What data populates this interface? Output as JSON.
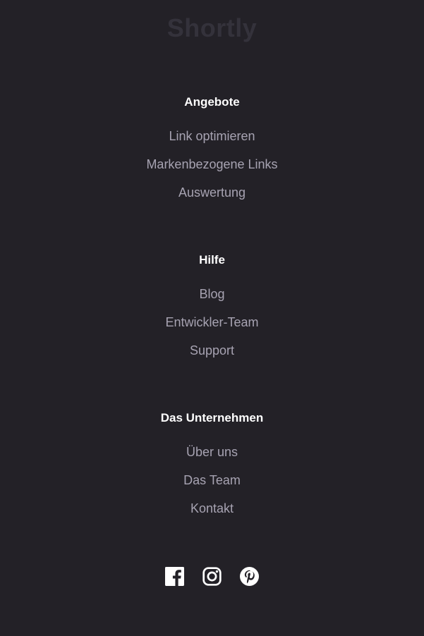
{
  "brand": {
    "logo_text": "Shortly"
  },
  "sections": [
    {
      "title": "Angebote",
      "links": [
        "Link optimieren",
        "Markenbezogene Links",
        "Auswertung"
      ]
    },
    {
      "title": "Hilfe",
      "links": [
        "Blog",
        "Entwickler-Team",
        "Support"
      ]
    },
    {
      "title": "Das Unternehmen",
      "links": [
        "Über uns",
        "Das Team",
        "Kontakt"
      ]
    }
  ],
  "social": {
    "icons": [
      "facebook-icon",
      "instagram-icon",
      "pinterest-icon"
    ]
  },
  "colors": {
    "background": "#232127",
    "heading": "#ffffff",
    "link": "#a7a3b2",
    "logo": "#34323b"
  }
}
